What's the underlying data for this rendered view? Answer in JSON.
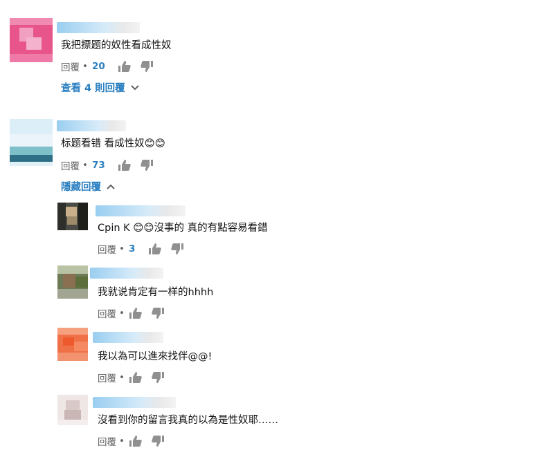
{
  "reply_label": "回覆",
  "comments": [
    {
      "text": "我把摽题的奴性看成性奴",
      "like_count": "20",
      "replies_toggle": "查看 4 則回覆"
    },
    {
      "text": "标题看错 看成性奴😊😊",
      "like_count": "73",
      "replies_toggle": "隱藏回覆",
      "replies": [
        {
          "text": "Cpin K 😊😊沒事的 真的有點容易看錯",
          "like_count": "3"
        },
        {
          "text": "我就说肯定有一样的hhhh",
          "like_count": ""
        },
        {
          "text": "我以為可以進來找伴@@!",
          "like_count": ""
        },
        {
          "text": "沒看到你的留言我真的以為是性奴耶……",
          "like_count": ""
        }
      ]
    }
  ],
  "colors": {
    "link_blue": "#2a7fc1",
    "secondary_text": "#606060",
    "icon_gray": "#909090"
  },
  "icons": [
    "thumbs-up-icon",
    "thumbs-down-icon",
    "chevron-down-icon",
    "chevron-up-icon"
  ]
}
